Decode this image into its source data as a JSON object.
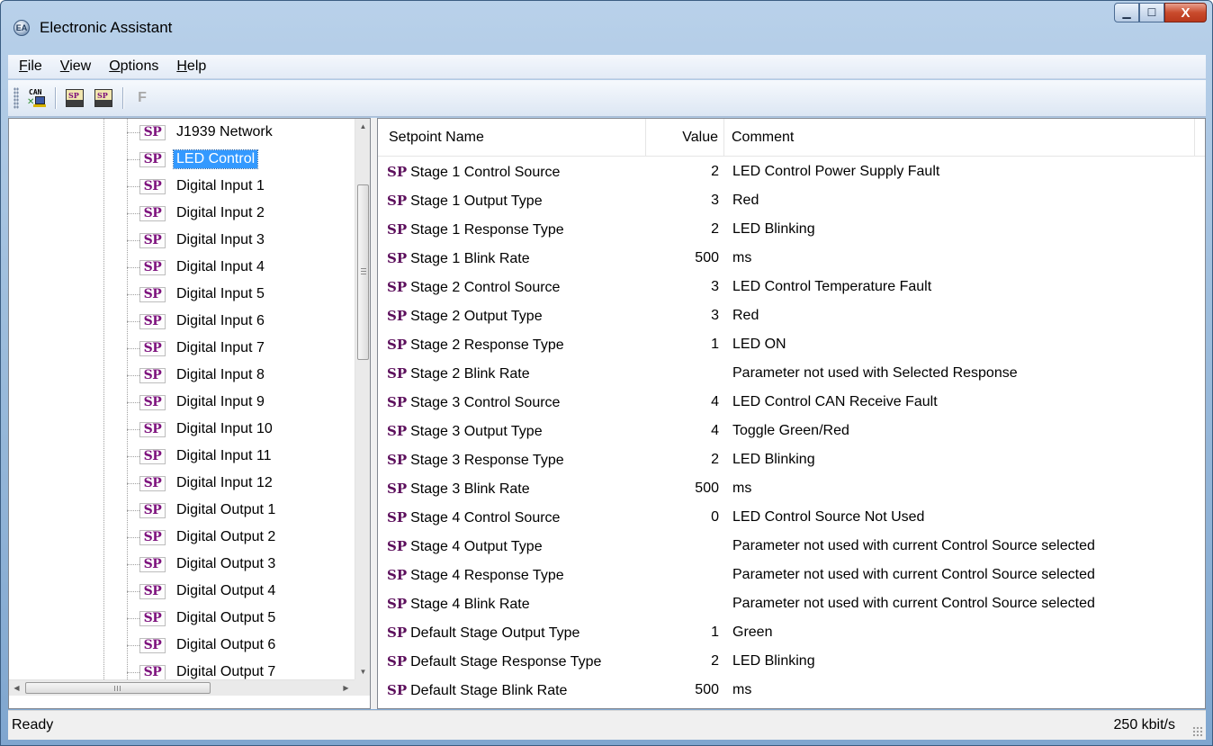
{
  "window": {
    "title": "Electronic Assistant",
    "app_icon": "EA",
    "controls": {
      "minimize": "▁",
      "maximize": "☐",
      "close": "X"
    }
  },
  "menu": [
    {
      "label": "File",
      "mnemonic": "F",
      "rest": "ile"
    },
    {
      "label": "View",
      "mnemonic": "V",
      "rest": "iew"
    },
    {
      "label": "Options",
      "mnemonic": "O",
      "rest": "ptions"
    },
    {
      "label": "Help",
      "mnemonic": "H",
      "rest": "elp"
    }
  ],
  "toolbar": {
    "buttons": [
      {
        "name": "can-connect-button",
        "icon": "can-network-icon",
        "text": "CAN"
      },
      {
        "name": "open-setpoint-file-button",
        "icon": "sp-open-icon",
        "text": "SP"
      },
      {
        "name": "save-setpoint-file-button",
        "icon": "sp-save-icon",
        "text": "SP"
      },
      {
        "name": "flash-button",
        "icon": "flash-f-icon",
        "text": "F",
        "disabled": true
      }
    ]
  },
  "tree": {
    "badge": "SP",
    "selected_index": 1,
    "items": [
      "J1939 Network",
      "LED Control",
      "Digital Input 1",
      "Digital Input 2",
      "Digital Input 3",
      "Digital Input 4",
      "Digital Input 5",
      "Digital Input 6",
      "Digital Input 7",
      "Digital Input 8",
      "Digital Input 9",
      "Digital Input 10",
      "Digital Input 11",
      "Digital Input 12",
      "Digital Output 1",
      "Digital Output 2",
      "Digital Output 3",
      "Digital Output 4",
      "Digital Output 5",
      "Digital Output 6",
      "Digital Output 7"
    ],
    "scroll_glyphs": {
      "up": "▲",
      "down": "▼",
      "left": "◀",
      "right": "▶"
    }
  },
  "list": {
    "columns": {
      "name": "Setpoint Name",
      "value": "Value",
      "comment": "Comment"
    },
    "badge": "SP",
    "rows": [
      {
        "name": "Stage 1 Control Source",
        "value": "2",
        "comment": "LED Control Power Supply Fault"
      },
      {
        "name": "Stage 1 Output Type",
        "value": "3",
        "comment": "Red"
      },
      {
        "name": "Stage 1 Response Type",
        "value": "2",
        "comment": "LED Blinking"
      },
      {
        "name": "Stage 1 Blink Rate",
        "value": "500",
        "comment": "ms"
      },
      {
        "name": "Stage 2 Control Source",
        "value": "3",
        "comment": "LED Control Temperature Fault"
      },
      {
        "name": "Stage 2 Output Type",
        "value": "3",
        "comment": "Red"
      },
      {
        "name": "Stage 2 Response Type",
        "value": "1",
        "comment": "LED ON"
      },
      {
        "name": "Stage 2 Blink Rate",
        "value": "",
        "comment": "Parameter not used with Selected Response"
      },
      {
        "name": "Stage 3 Control Source",
        "value": "4",
        "comment": "LED Control CAN Receive Fault"
      },
      {
        "name": "Stage 3 Output Type",
        "value": "4",
        "comment": "Toggle Green/Red"
      },
      {
        "name": "Stage 3 Response Type",
        "value": "2",
        "comment": "LED Blinking"
      },
      {
        "name": "Stage 3 Blink Rate",
        "value": "500",
        "comment": "ms"
      },
      {
        "name": "Stage 4 Control Source",
        "value": "0",
        "comment": "LED Control Source Not Used"
      },
      {
        "name": "Stage 4 Output Type",
        "value": "",
        "comment": "Parameter not used with current Control Source selected"
      },
      {
        "name": "Stage 4 Response Type",
        "value": "",
        "comment": "Parameter not used with current Control Source selected"
      },
      {
        "name": "Stage 4 Blink Rate",
        "value": "",
        "comment": "Parameter not used with current Control Source selected"
      },
      {
        "name": "Default Stage Output Type",
        "value": "1",
        "comment": "Green"
      },
      {
        "name": "Default Stage Response Type",
        "value": "2",
        "comment": "LED Blinking"
      },
      {
        "name": "Default Stage Blink Rate",
        "value": "500",
        "comment": "ms"
      }
    ]
  },
  "status": {
    "left": "Ready",
    "right": "250 kbit/s"
  },
  "colors": {
    "selection": "#3399ff",
    "sp_badge": "#7d117d",
    "title_bar": "#9fbedd"
  }
}
